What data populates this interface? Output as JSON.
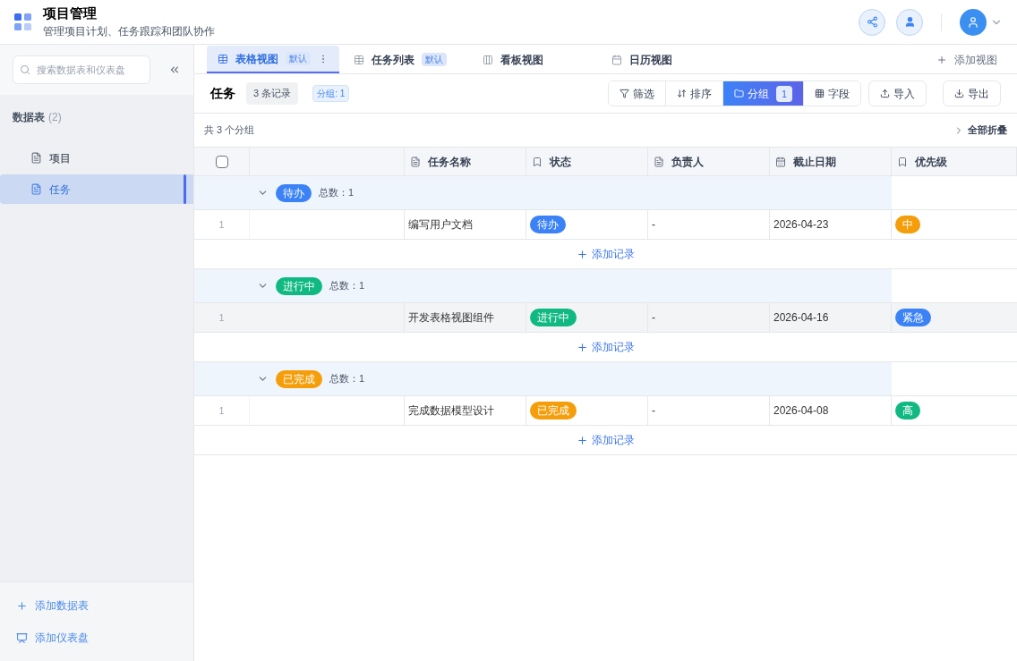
{
  "app": {
    "title": "项目管理",
    "subtitle": "管理项目计划、任务跟踪和团队协作"
  },
  "sidebar": {
    "search": {
      "placeholder": "搜索数据表和仪表盘"
    },
    "section": {
      "label": "数据表",
      "count": "(2)"
    },
    "items": [
      {
        "label": "项目",
        "selected": false
      },
      {
        "label": "任务",
        "selected": true
      }
    ],
    "actions": [
      {
        "kind": "add",
        "label": "添加数据表"
      },
      {
        "kind": "dashboard",
        "label": "添加仪表盘"
      }
    ]
  },
  "tabs": [
    {
      "kind": "grid",
      "label": "表格视图",
      "badge": "默认",
      "selected": true
    },
    {
      "kind": "grid",
      "label": "任务列表",
      "badge": "默认",
      "selected": false
    },
    {
      "kind": "board",
      "label": "看板视图",
      "selected": false
    },
    {
      "kind": "calendar",
      "label": "日历视图",
      "selected": false
    }
  ],
  "add_view": "添加视图",
  "table_title": "任务",
  "record_count": "3 条记录",
  "group_tag": "分组: 1",
  "toolbar": [
    {
      "kind": "filter",
      "label": "筛选",
      "selected": false
    },
    {
      "kind": "sort",
      "label": "排序",
      "selected": false
    },
    {
      "kind": "group",
      "label": "分组",
      "count": "1",
      "selected": true
    },
    {
      "kind": "fields",
      "label": "字段",
      "selected": false
    }
  ],
  "import": "导入",
  "export": "导出",
  "group_summary": "共 3 个分组",
  "collapse_all": "全部折叠",
  "select_all": {
    "checked": false
  },
  "columns": [
    {
      "kind": "text",
      "label": "任务名称"
    },
    {
      "kind": "tag",
      "label": "状态"
    },
    {
      "kind": "text",
      "label": "负责人"
    },
    {
      "kind": "date",
      "label": "截止日期"
    },
    {
      "kind": "tag",
      "label": "优先级"
    }
  ],
  "groups": [
    {
      "label": "待办",
      "color": "#3b82f6",
      "total": "总数：1",
      "expanded": true,
      "rows": [
        {
          "index": "1",
          "name": "编写用户文档",
          "status": {
            "label": "待办",
            "color": "#3b82f6"
          },
          "owner": "-",
          "due": "2026-04-23",
          "priority": {
            "label": "中",
            "color": "#f59e0b"
          },
          "hovered": false
        }
      ],
      "add": "添加记录"
    },
    {
      "label": "进行中",
      "color": "#10b981",
      "total": "总数：1",
      "expanded": true,
      "rows": [
        {
          "index": "1",
          "name": "开发表格视图组件",
          "status": {
            "label": "进行中",
            "color": "#10b981"
          },
          "owner": "-",
          "due": "2026-04-16",
          "priority": {
            "label": "紧急",
            "color": "#3b82f6"
          },
          "hovered": true
        }
      ],
      "add": "添加记录"
    },
    {
      "label": "已完成",
      "color": "#f59e0b",
      "total": "总数：1",
      "expanded": true,
      "rows": [
        {
          "index": "1",
          "name": "完成数据模型设计",
          "status": {
            "label": "已完成",
            "color": "#f59e0b"
          },
          "owner": "-",
          "due": "2026-04-08",
          "priority": {
            "label": "高",
            "color": "#10b981"
          },
          "hovered": false
        }
      ],
      "add": "添加记录"
    }
  ]
}
